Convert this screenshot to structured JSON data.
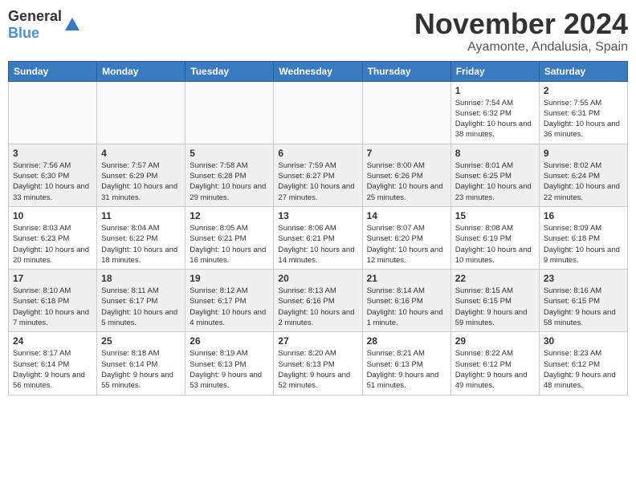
{
  "header": {
    "logo_line1": "General",
    "logo_line2": "Blue",
    "month_title": "November 2024",
    "location": "Ayamonte, Andalusia, Spain"
  },
  "days_of_week": [
    "Sunday",
    "Monday",
    "Tuesday",
    "Wednesday",
    "Thursday",
    "Friday",
    "Saturday"
  ],
  "weeks": [
    [
      {
        "day": "",
        "info": "",
        "empty": true
      },
      {
        "day": "",
        "info": "",
        "empty": true
      },
      {
        "day": "",
        "info": "",
        "empty": true
      },
      {
        "day": "",
        "info": "",
        "empty": true
      },
      {
        "day": "",
        "info": "",
        "empty": true
      },
      {
        "day": "1",
        "info": "Sunrise: 7:54 AM\nSunset: 6:32 PM\nDaylight: 10 hours and 38 minutes."
      },
      {
        "day": "2",
        "info": "Sunrise: 7:55 AM\nSunset: 6:31 PM\nDaylight: 10 hours and 36 minutes."
      }
    ],
    [
      {
        "day": "3",
        "info": "Sunrise: 7:56 AM\nSunset: 6:30 PM\nDaylight: 10 hours and 33 minutes."
      },
      {
        "day": "4",
        "info": "Sunrise: 7:57 AM\nSunset: 6:29 PM\nDaylight: 10 hours and 31 minutes."
      },
      {
        "day": "5",
        "info": "Sunrise: 7:58 AM\nSunset: 6:28 PM\nDaylight: 10 hours and 29 minutes."
      },
      {
        "day": "6",
        "info": "Sunrise: 7:59 AM\nSunset: 6:27 PM\nDaylight: 10 hours and 27 minutes."
      },
      {
        "day": "7",
        "info": "Sunrise: 8:00 AM\nSunset: 6:26 PM\nDaylight: 10 hours and 25 minutes."
      },
      {
        "day": "8",
        "info": "Sunrise: 8:01 AM\nSunset: 6:25 PM\nDaylight: 10 hours and 23 minutes."
      },
      {
        "day": "9",
        "info": "Sunrise: 8:02 AM\nSunset: 6:24 PM\nDaylight: 10 hours and 22 minutes."
      }
    ],
    [
      {
        "day": "10",
        "info": "Sunrise: 8:03 AM\nSunset: 6:23 PM\nDaylight: 10 hours and 20 minutes."
      },
      {
        "day": "11",
        "info": "Sunrise: 8:04 AM\nSunset: 6:22 PM\nDaylight: 10 hours and 18 minutes."
      },
      {
        "day": "12",
        "info": "Sunrise: 8:05 AM\nSunset: 6:21 PM\nDaylight: 10 hours and 16 minutes."
      },
      {
        "day": "13",
        "info": "Sunrise: 8:06 AM\nSunset: 6:21 PM\nDaylight: 10 hours and 14 minutes."
      },
      {
        "day": "14",
        "info": "Sunrise: 8:07 AM\nSunset: 6:20 PM\nDaylight: 10 hours and 12 minutes."
      },
      {
        "day": "15",
        "info": "Sunrise: 8:08 AM\nSunset: 6:19 PM\nDaylight: 10 hours and 10 minutes."
      },
      {
        "day": "16",
        "info": "Sunrise: 8:09 AM\nSunset: 6:18 PM\nDaylight: 10 hours and 9 minutes."
      }
    ],
    [
      {
        "day": "17",
        "info": "Sunrise: 8:10 AM\nSunset: 6:18 PM\nDaylight: 10 hours and 7 minutes."
      },
      {
        "day": "18",
        "info": "Sunrise: 8:11 AM\nSunset: 6:17 PM\nDaylight: 10 hours and 5 minutes."
      },
      {
        "day": "19",
        "info": "Sunrise: 8:12 AM\nSunset: 6:17 PM\nDaylight: 10 hours and 4 minutes."
      },
      {
        "day": "20",
        "info": "Sunrise: 8:13 AM\nSunset: 6:16 PM\nDaylight: 10 hours and 2 minutes."
      },
      {
        "day": "21",
        "info": "Sunrise: 8:14 AM\nSunset: 6:16 PM\nDaylight: 10 hours and 1 minute."
      },
      {
        "day": "22",
        "info": "Sunrise: 8:15 AM\nSunset: 6:15 PM\nDaylight: 9 hours and 59 minutes."
      },
      {
        "day": "23",
        "info": "Sunrise: 8:16 AM\nSunset: 6:15 PM\nDaylight: 9 hours and 58 minutes."
      }
    ],
    [
      {
        "day": "24",
        "info": "Sunrise: 8:17 AM\nSunset: 6:14 PM\nDaylight: 9 hours and 56 minutes."
      },
      {
        "day": "25",
        "info": "Sunrise: 8:18 AM\nSunset: 6:14 PM\nDaylight: 9 hours and 55 minutes."
      },
      {
        "day": "26",
        "info": "Sunrise: 8:19 AM\nSunset: 6:13 PM\nDaylight: 9 hours and 53 minutes."
      },
      {
        "day": "27",
        "info": "Sunrise: 8:20 AM\nSunset: 6:13 PM\nDaylight: 9 hours and 52 minutes."
      },
      {
        "day": "28",
        "info": "Sunrise: 8:21 AM\nSunset: 6:13 PM\nDaylight: 9 hours and 51 minutes."
      },
      {
        "day": "29",
        "info": "Sunrise: 8:22 AM\nSunset: 6:12 PM\nDaylight: 9 hours and 49 minutes."
      },
      {
        "day": "30",
        "info": "Sunrise: 8:23 AM\nSunset: 6:12 PM\nDaylight: 9 hours and 48 minutes."
      }
    ]
  ]
}
